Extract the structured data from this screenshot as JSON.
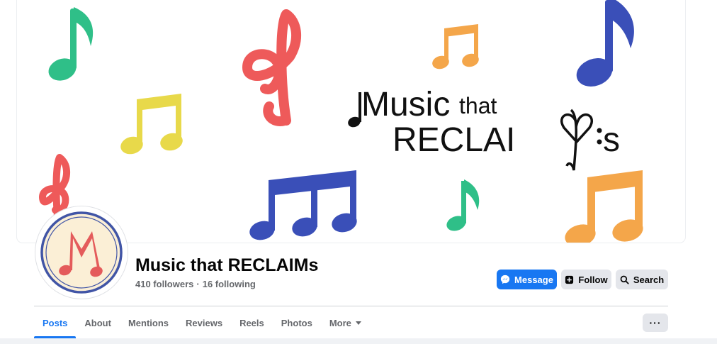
{
  "cover": {
    "logo_line1_a": "Music",
    "logo_line1_b": "that",
    "logo_line2_a": "RECLAI",
    "logo_line2_b": "s",
    "colors": {
      "green": "#2fbf88",
      "red": "#ee5a5a",
      "yellow": "#e8d94a",
      "orange": "#f4a64a",
      "blue": "#3a4fb8"
    }
  },
  "avatar": {
    "letter": "M",
    "colors": {
      "ring": "#4155a6",
      "fill": "#fbefd6",
      "letter": "#e45b5b"
    }
  },
  "page": {
    "name": "Music that RECLAIMs",
    "followers": "410 followers",
    "separator": "·",
    "following": "16 following"
  },
  "actions": {
    "message": "Message",
    "follow": "Follow",
    "search": "Search",
    "more": "···"
  },
  "tabs": [
    {
      "label": "Posts",
      "active": true
    },
    {
      "label": "About"
    },
    {
      "label": "Mentions"
    },
    {
      "label": "Reviews"
    },
    {
      "label": "Reels"
    },
    {
      "label": "Photos"
    },
    {
      "label": "More"
    }
  ],
  "icons": {
    "message": "messenger-icon",
    "follow": "follow-icon",
    "search": "search-icon",
    "more": "caret-down-icon"
  },
  "accent": "#1877f2"
}
